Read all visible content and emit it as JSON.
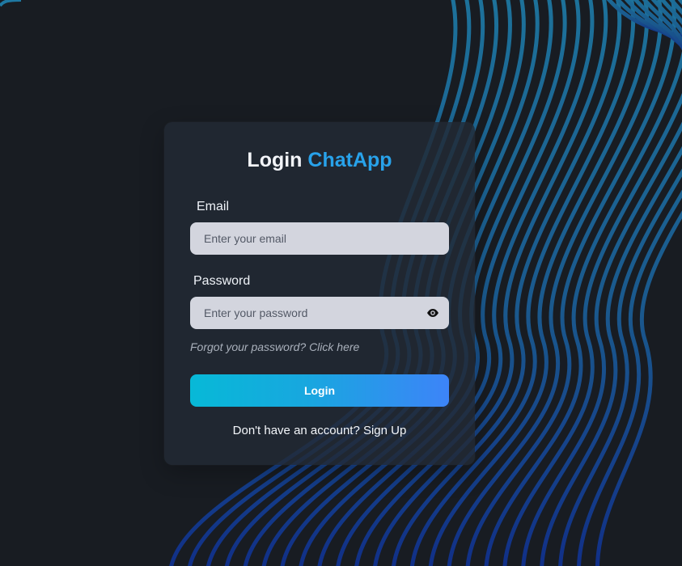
{
  "app": {
    "title_prefix": "Login",
    "title_brand": "ChatApp",
    "brand_color": "#28a2ea"
  },
  "form": {
    "email_label": "Email",
    "email_placeholder": "Enter your email",
    "password_label": "Password",
    "password_placeholder": "Enter your password",
    "forgot_text": "Forgot your password? Click here",
    "login_label": "Login",
    "signup_text": "Don't have an account? Sign Up"
  },
  "icons": {
    "password_toggle": "eye-icon"
  },
  "colors": {
    "background": "#181c22",
    "card": "#222934",
    "input": "#d3d5de",
    "button_start": "#07b9d7",
    "button_end": "#3d84f8",
    "wave": "#1f6f9a"
  }
}
